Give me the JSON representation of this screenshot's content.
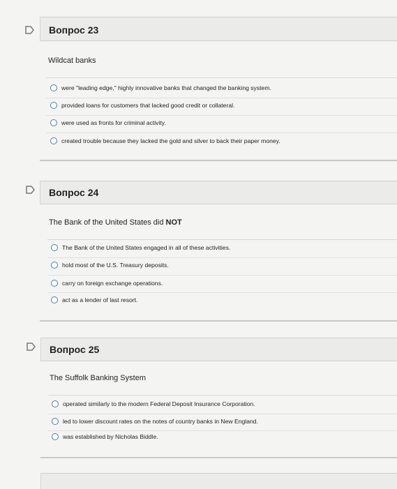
{
  "questions": [
    {
      "title": "Вопрос 23",
      "prompt": "Wildcat banks",
      "options": [
        "were \"leading edge,\" highly innovative banks that changed the banking system.",
        "provided loans for customers that lacked good credit or collateral.",
        "were used as fronts for criminal activity.",
        "created trouble because they lacked the gold and silver to back their paper money."
      ]
    },
    {
      "title": "Вопрос 24",
      "prompt_pre": "The Bank of the United States did ",
      "prompt_bold": "NOT",
      "options": [
        "The Bank of the United States engaged in all of these activities.",
        "hold most of the U.S. Treasury deposits.",
        "carry on foreign exchange operations.",
        "act as a lender of last resort."
      ]
    },
    {
      "title": "Вопрос 25",
      "prompt": "The Suffolk Banking System",
      "options": [
        "operated similarly to the modern Federal Deposit Insurance Corporation.",
        "led to lower discount rates on the notes of country banks in New England.",
        "was established by Nicholas Biddle."
      ]
    }
  ],
  "colors": {
    "flag": "#7a7a7a",
    "radio_border": "#4a7eb0",
    "header_bg": "#ebebe9"
  },
  "icons": {
    "flag": "flag-icon"
  }
}
